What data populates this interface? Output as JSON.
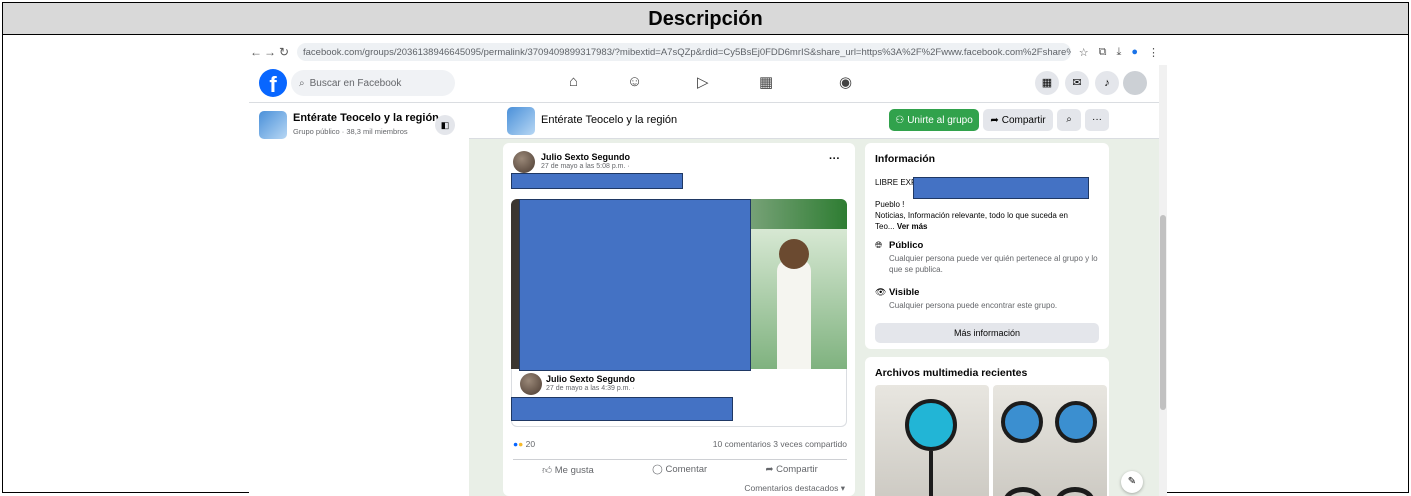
{
  "header": {
    "title": "Descripción"
  },
  "browser": {
    "url": "facebook.com/groups/2036138946645095/permalink/3709409899317983/?mibextid=A7sQZp&rdid=Cy5BsEj0FDD6mrIS&share_url=https%3A%2F%2Fwww.facebook.com%2Fshare%..."
  },
  "fb": {
    "search_placeholder": "Buscar en Facebook"
  },
  "group": {
    "name": "Entérate Teocelo y la región",
    "sidebar_sub": "Grupo público · 38,3 mil miembros",
    "join_label": "Unirte al grupo",
    "share_label": "Compartir"
  },
  "post": {
    "author": "Julio Sexto Segundo",
    "date": "27 de mayo a las 5:08 p.m. ·",
    "shared_author": "Julio Sexto Segundo",
    "shared_date": "27 de mayo a las 4:39 p.m. ·",
    "reactions": "20",
    "comments": "10 comentarios",
    "shares": "3 veces compartido",
    "like_label": "Me gusta",
    "comment_label": "Comentar",
    "share_label": "Compartir",
    "featured_label": "Comentarios destacados ▾",
    "more_dots": "···"
  },
  "info": {
    "title": "Información",
    "line1": "LIBRE EXPRESION EN TEOCELO",
    "line2": "Pueblo !",
    "line3": "Noticias, Información relevante, todo lo que suceda en",
    "line4": "Teo...",
    "see_more": "Ver más",
    "public_title": "Público",
    "public_desc": "Cualquier persona puede ver quién pertenece al grupo y lo que se publica.",
    "visible_title": "Visible",
    "visible_desc": "Cualquier persona puede encontrar este grupo.",
    "more_info": "Más información"
  },
  "media": {
    "title": "Archivos multimedia recientes"
  }
}
